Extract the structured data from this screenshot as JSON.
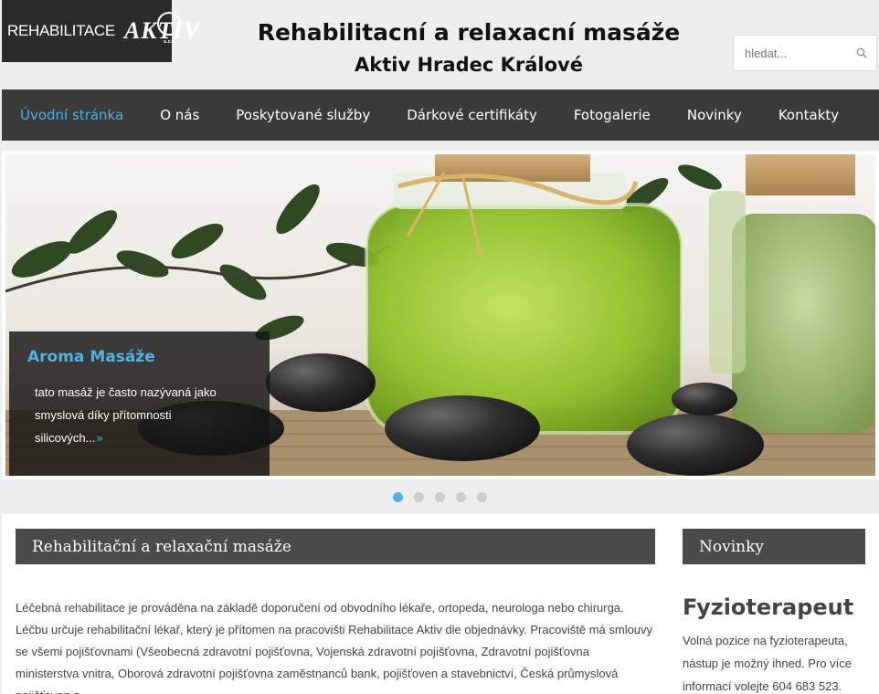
{
  "header": {
    "logo_text": "REHABILITACE",
    "logo_mark": "AKTIV",
    "logo_small": "s.r.o.",
    "title_line1": "Rehabilitacní a relaxacní masáže",
    "title_line2": "Aktiv Hradec Králové",
    "search_placeholder": "hledat...",
    "search_icon": "magnifier-icon"
  },
  "nav": {
    "items": [
      {
        "label": "Úvodní stránka",
        "active": true
      },
      {
        "label": "O nás"
      },
      {
        "label": "Poskytované služby"
      },
      {
        "label": "Dárkové certifikáty"
      },
      {
        "label": "Fotogalerie"
      },
      {
        "label": "Novinky"
      },
      {
        "label": "Kontakty"
      }
    ]
  },
  "slider": {
    "caption_title": "Aroma Masáže",
    "caption_text": "tato masáž je často nazývaná jako smyslová díky přítomnosti silicových...",
    "caption_more": "»",
    "dot_count": 5,
    "active_dot": 1
  },
  "main": {
    "heading": "Rehabilitační a relaxační masáže",
    "paragraph": "Léčebná rehabilitace je prováděna na základě doporučení od obvodního lékaře, ortopeda, neurologa nebo chirurga. Léčbu určuje rehabilitační lékař, který je přítomen na pracovišti Rehabilitace Aktiv dle objednávky. Pracoviště má smlouvy se všemi pojišťovnami (Všeobecná zdravotní pojišťovna, Vojenská zdravotní pojišťovna, Zdravotní pojišťovna ministerstva vnitra, Oborová zdravotní pojišťovna zaměstnanců bank, pojišťoven a stavebnictví, Česká průmyslová pojišťovan a"
  },
  "sidebar": {
    "heading": "Novinky",
    "news_title": "Fyzioterapeut",
    "news_text": "Volná pozice na fyzioterapeuta, nástup je možný ihned. Pro více informací volejte 604 683 523."
  },
  "colors": {
    "accent": "#4fb3e3",
    "nav_bg": "#3a3a3a",
    "heading_bg": "#4b4b4b"
  }
}
